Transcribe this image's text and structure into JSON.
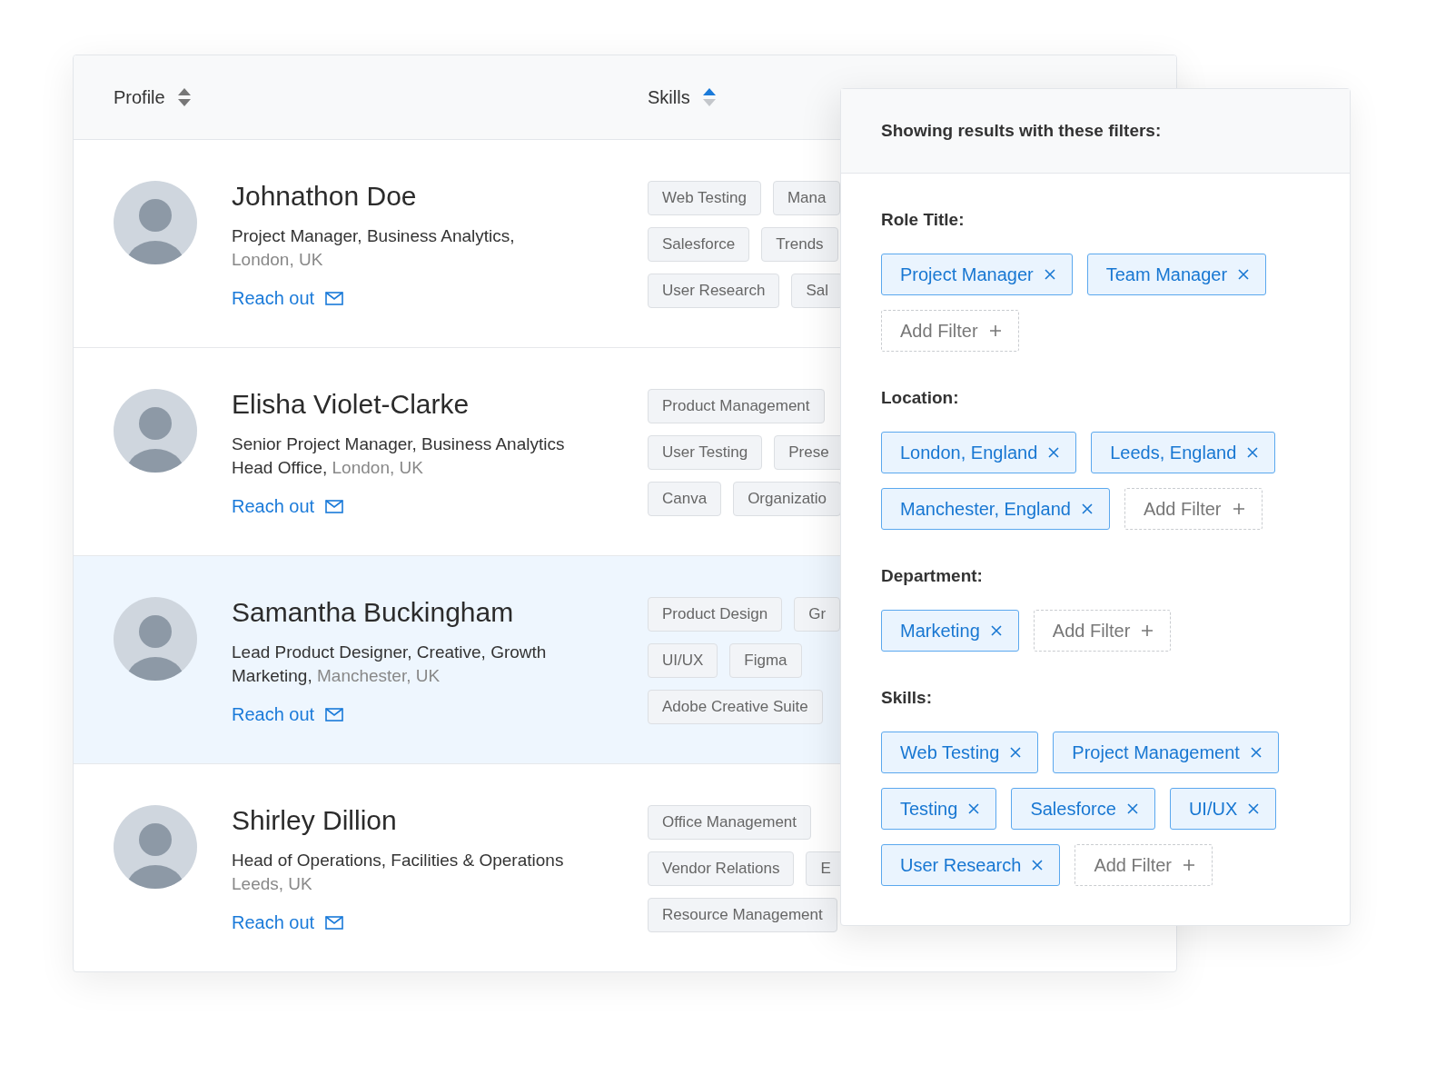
{
  "table": {
    "columns": [
      {
        "label": "Profile",
        "sorted": false
      },
      {
        "label": "Skills",
        "sorted": true
      }
    ],
    "rows": [
      {
        "name": "Johnathon Doe",
        "selected": false,
        "description": [
          [
            {
              "text": "Project Manager, Business Analytics,",
              "muted": false
            }
          ],
          [
            {
              "text": "London, UK",
              "muted": true
            }
          ]
        ],
        "link": "Reach out",
        "skills": [
          [
            "Web Testing",
            "Mana"
          ],
          [
            "Salesforce",
            "Trends"
          ],
          [
            "User Research",
            "Sal"
          ]
        ]
      },
      {
        "name": "Elisha Violet-Clarke",
        "selected": false,
        "description": [
          [
            {
              "text": "Senior Project Manager, Business Analytics",
              "muted": false
            }
          ],
          [
            {
              "text": "Head Office,",
              "muted": false
            },
            {
              "text": "London, UK",
              "muted": true
            }
          ]
        ],
        "link": "Reach out",
        "skills": [
          [
            "Product Management"
          ],
          [
            "User Testing",
            "Prese"
          ],
          [
            "Canva",
            "Organizatio"
          ]
        ]
      },
      {
        "name": "Samantha Buckingham",
        "selected": true,
        "description": [
          [
            {
              "text": "Lead Product Designer, Creative, Growth",
              "muted": false
            }
          ],
          [
            {
              "text": "Marketing,",
              "muted": false
            },
            {
              "text": "Manchester, UK",
              "muted": true
            }
          ]
        ],
        "link": "Reach out",
        "skills": [
          [
            "Product Design",
            "Gr"
          ],
          [
            "UI/UX",
            "Figma"
          ],
          [
            "Adobe Creative Suite"
          ]
        ]
      },
      {
        "name": "Shirley Dillion",
        "selected": false,
        "description": [
          [
            {
              "text": "Head of Operations, Facilities & Operations",
              "muted": false
            }
          ],
          [
            {
              "text": "Leeds, UK",
              "muted": true
            }
          ]
        ],
        "link": "Reach out",
        "skills": [
          [
            "Office Management"
          ],
          [
            "Vendor Relations",
            "E"
          ],
          [
            "Resource Management"
          ]
        ]
      }
    ]
  },
  "filters": {
    "title": "Showing results with these filters:",
    "sections": [
      {
        "label": "Role Title:",
        "chips": [
          "Project Manager",
          "Team Manager"
        ],
        "add_label": "Add Filter"
      },
      {
        "label": "Location:",
        "chips": [
          "London, England",
          "Leeds, England",
          "Manchester, England"
        ],
        "add_label": "Add Filter"
      },
      {
        "label": "Department:",
        "chips": [
          "Marketing"
        ],
        "add_label": "Add Filter"
      },
      {
        "label": "Skills:",
        "chips": [
          "Web Testing",
          "Project Management",
          "Testing",
          "Salesforce",
          "UI/UX",
          "User Research"
        ],
        "add_label": "Add Filter"
      }
    ]
  }
}
